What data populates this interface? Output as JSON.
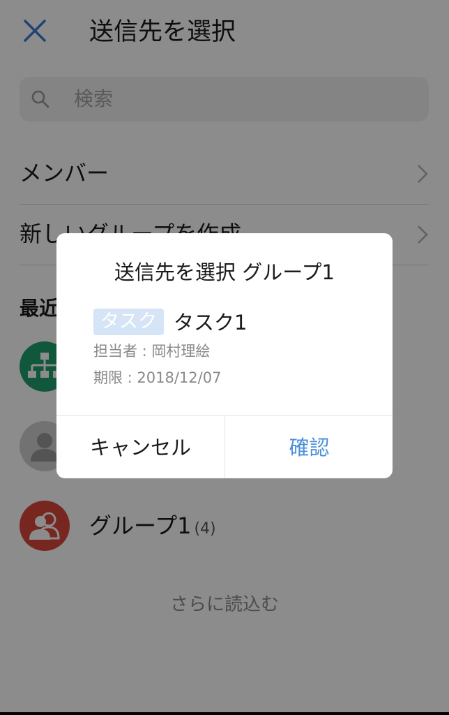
{
  "header": {
    "title": "送信先を選択",
    "close_icon": "close-icon"
  },
  "search": {
    "placeholder": "検索",
    "icon": "search-icon"
  },
  "menu": [
    {
      "label": "メンバー"
    },
    {
      "label": "新しいグループを作成"
    }
  ],
  "recent": {
    "section_label": "最近",
    "items": [
      {
        "icon": "org-chart-icon",
        "color": "#1f9e6e",
        "name": ""
      },
      {
        "icon": "person-icon",
        "color": "#cfcfcf",
        "name": ""
      },
      {
        "icon": "group-icon",
        "color": "#d9453b",
        "name": "グループ1",
        "count": "(4)"
      }
    ],
    "load_more": "さらに読込む"
  },
  "dialog": {
    "title": "送信先を選択 グループ1",
    "tag": "タスク",
    "task_name": "タスク1",
    "assignee": "担当者 : 岡村理絵",
    "deadline": "期限 : 2018/12/07",
    "cancel_label": "キャンセル",
    "confirm_label": "確認",
    "colors": {
      "accent": "#4a8fd8",
      "tag_bg": "#d6e4f7"
    }
  }
}
